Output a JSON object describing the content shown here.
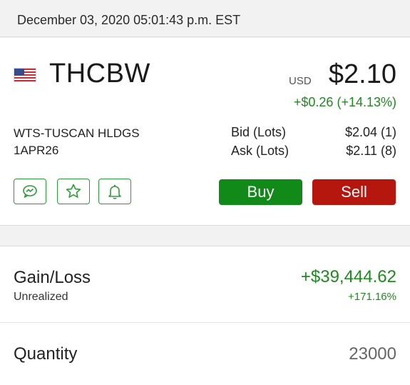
{
  "header": {
    "timestamp": "December 03, 2020 05:01:43 p.m. EST"
  },
  "quote": {
    "flag_icon": "us-flag-icon",
    "symbol": "THCBW",
    "currency": "USD",
    "price": "$2.10",
    "change": "+$0.26 (+14.13%)",
    "description_line1": "WTS-TUSCAN HLDGS",
    "description_line2": "1APR26",
    "bid_label": "Bid (Lots)",
    "bid_value": "$2.04 (1)",
    "ask_label": "Ask (Lots)",
    "ask_value": "$2.11 (8)",
    "positive_color": "#1f8a1f"
  },
  "actions": {
    "icons": [
      "chat-icon",
      "star-icon",
      "bell-icon"
    ],
    "buy_label": "Buy",
    "sell_label": "Sell",
    "buy_color": "#118a1a",
    "sell_color": "#b5160e"
  },
  "position": {
    "gain_label": "Gain/Loss",
    "gain_sublabel": "Unrealized",
    "gain_value": "+$39,444.62",
    "gain_percent": "+171.16%",
    "quantity_label": "Quantity",
    "quantity_value": "23000"
  }
}
